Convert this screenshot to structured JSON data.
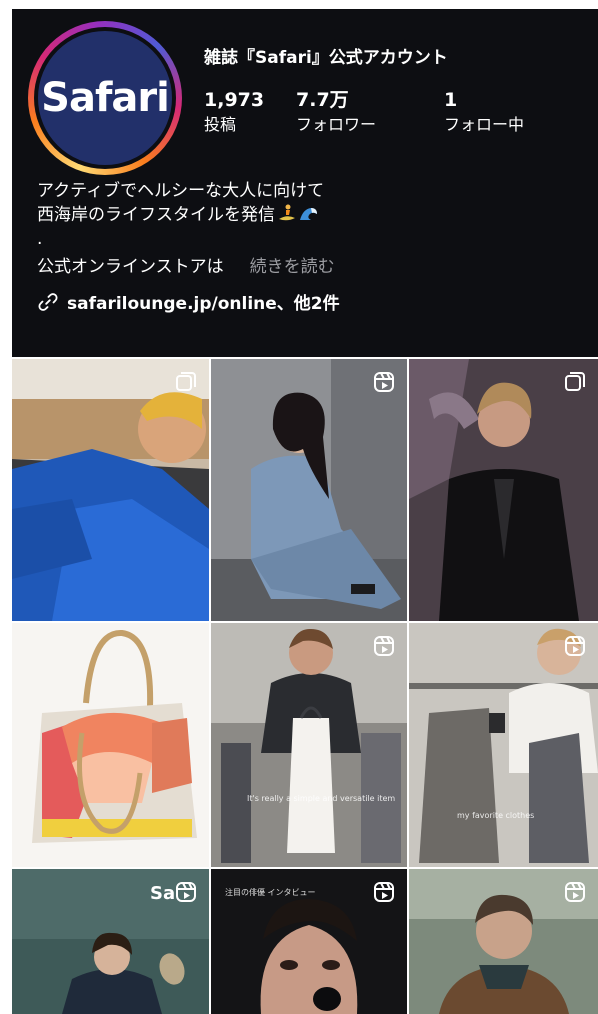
{
  "profile": {
    "account_name": "雑誌『Safari』公式アカウント",
    "avatar_logo_text": "Safari",
    "stats": {
      "posts": {
        "count": "1,973",
        "label": "投稿"
      },
      "followers": {
        "count": "7.7万",
        "label": "フォロワー"
      },
      "following": {
        "count": "1",
        "label": "フォロー中"
      }
    },
    "bio": {
      "line1": "アクティブでヘルシーな大人に向けて",
      "line2": "西海岸のライフスタイルを発信",
      "line3": ".",
      "line4": "公式オンラインストアは",
      "more_label": "続きを読む",
      "link": "safarilounge.jp/online、他2件"
    }
  },
  "icons": {
    "link": "link-icon",
    "carousel": "carousel-icon",
    "reel": "reel-icon"
  },
  "grid": {
    "tiles": [
      {
        "kind": "carousel",
        "subject": "man in blue jacket driving"
      },
      {
        "kind": "reel",
        "subject": "woman in denim sitting"
      },
      {
        "kind": "carousel",
        "subject": "man in black suit"
      },
      {
        "kind": "none",
        "subject": "striped tote bag"
      },
      {
        "kind": "reel",
        "subject": "man holding white tank top",
        "caption": "It's really a simple and versatile item"
      },
      {
        "kind": "reel",
        "subject": "man with jacket on rack",
        "caption": "my favorite clothes"
      },
      {
        "kind": "reel",
        "subject": "woman in dark jacket",
        "logo": "Sa"
      },
      {
        "kind": "reel",
        "subject": "man applying makeup",
        "caption": "注目の俳優 インタビュー"
      },
      {
        "kind": "reel",
        "subject": "man in brown jacket outdoors"
      }
    ]
  },
  "colors": {
    "profile_bg": "#0d0e12",
    "avatar_bg": "#22306a",
    "muted_text": "#9b9ca1"
  }
}
